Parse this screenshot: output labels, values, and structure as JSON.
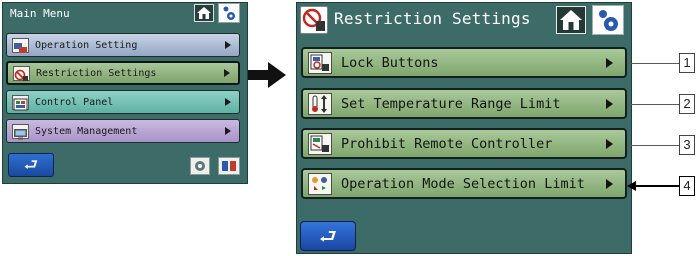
{
  "main_menu": {
    "title": "Main Menu",
    "items": [
      {
        "label": "Operation Setting",
        "icon": "operation-setting-icon"
      },
      {
        "label": "Restriction Settings",
        "icon": "restriction-settings-icon"
      },
      {
        "label": "Control Panel",
        "icon": "control-panel-icon"
      },
      {
        "label": "System Management",
        "icon": "system-management-icon"
      }
    ],
    "back_glyph": "⮐"
  },
  "restriction": {
    "title": "Restriction Settings",
    "items": [
      {
        "label": "Lock Buttons",
        "icon": "lock-buttons-icon",
        "callout": "1"
      },
      {
        "label": "Set Temperature Range Limit",
        "icon": "temperature-range-icon",
        "callout": "2"
      },
      {
        "label": "Prohibit Remote Controller",
        "icon": "prohibit-remote-icon",
        "callout": "3"
      },
      {
        "label": "Operation Mode Selection Limit",
        "icon": "mode-selection-icon",
        "callout": "4"
      }
    ],
    "back_glyph": "⮐"
  },
  "colors": {
    "panel_bg": "#3d6b68",
    "restriction_item": "#8fb37e",
    "operation_item": "#a9b8d4",
    "control_item": "#6fc1b4",
    "system_item": "#b7a4d3",
    "back_button": "#2458b8"
  }
}
